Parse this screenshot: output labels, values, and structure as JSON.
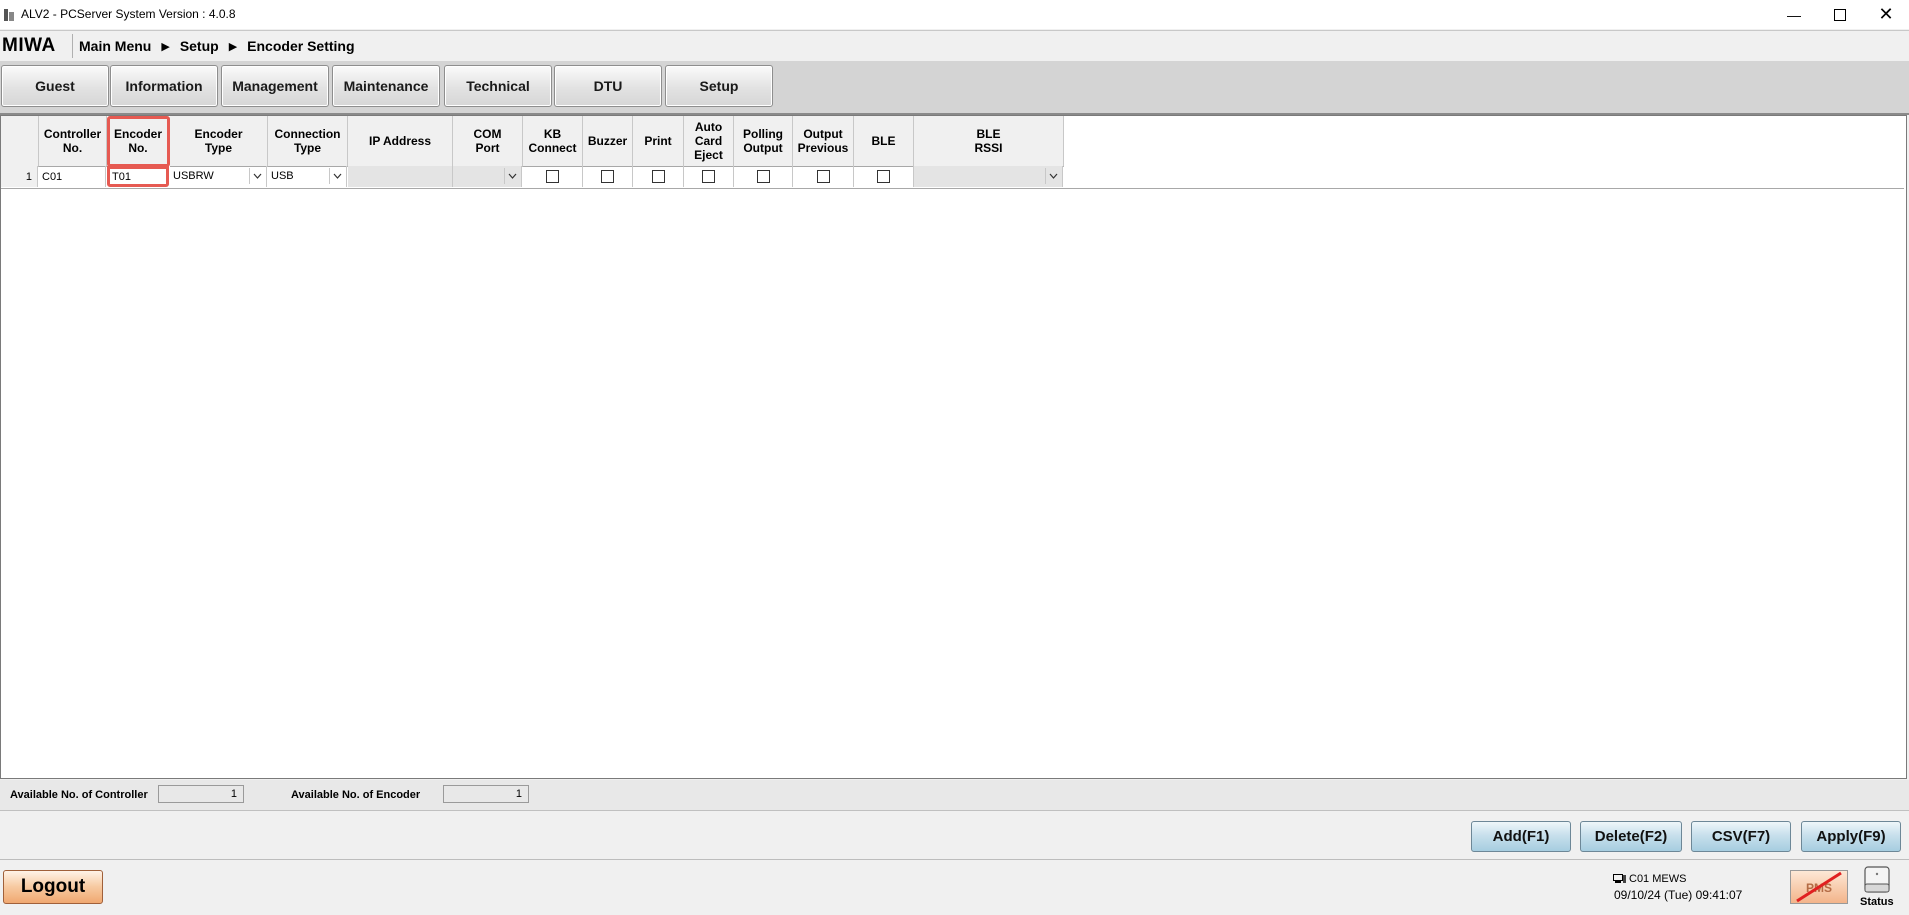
{
  "window": {
    "title": "ALV2 - PCServer System Version : 4.0.8"
  },
  "breadcrumb": {
    "logo": "MIWA",
    "items": [
      "Main Menu",
      "Setup",
      "Encoder Setting"
    ]
  },
  "menu": {
    "items": [
      "Guest",
      "Information",
      "Management",
      "Maintenance",
      "Technical",
      "DTU",
      "Setup"
    ]
  },
  "grid": {
    "headers": [
      "Controller\nNo.",
      "Encoder\nNo.",
      "Encoder\nType",
      "Connection\nType",
      "IP Address",
      "COM\nPort",
      "KB\nConnect",
      "Buzzer",
      "Print",
      "Auto\nCard\nEject",
      "Polling\nOutput",
      "Output\nPrevious",
      "BLE",
      "BLE\nRSSI"
    ],
    "rows": [
      {
        "row_no": "1",
        "controller_no": "C01",
        "encoder_no": "T01",
        "encoder_type": "USBRW",
        "connection_type": "USB",
        "ip_address": "",
        "com_port": "",
        "ble_rssi": ""
      }
    ]
  },
  "info": {
    "controller_label": "Available No. of Controller",
    "controller_value": "1",
    "encoder_label": "Available No. of Encoder",
    "encoder_value": "1"
  },
  "actions": {
    "add": "Add(F1)",
    "delete": "Delete(F2)",
    "csv": "CSV(F7)",
    "apply": "Apply(F9)"
  },
  "status": {
    "logout": "Logout",
    "terminal": "C01 MEWS",
    "datetime": "09/10/24 (Tue) 09:41:07",
    "pms_label": "PMS",
    "status_label": "Status"
  },
  "colors": {
    "highlight": "#e65a52",
    "logout_bg": "#f7c9a0",
    "action_bg": "#c8e0ec"
  }
}
